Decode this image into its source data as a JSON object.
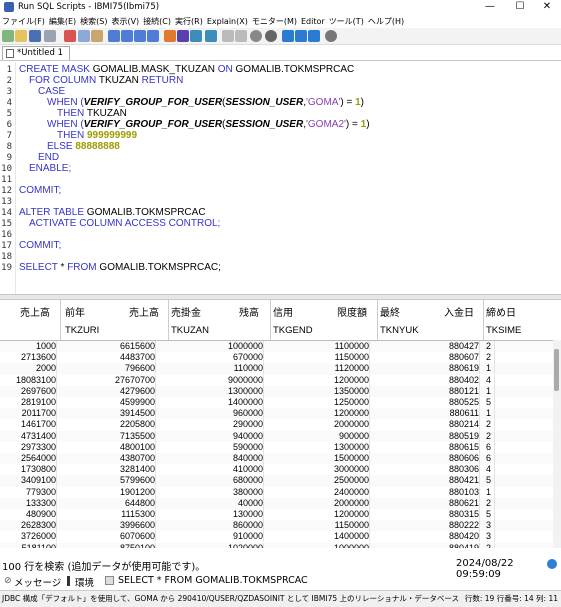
{
  "window": {
    "title": "Run SQL Scripts - IBMI75(Ibmi75)"
  },
  "menu": [
    "ファイル(F)",
    "編集(E)",
    "検索(S)",
    "表示(V)",
    "接続(C)",
    "実行(R)",
    "Explain(X)",
    "モニター(M)",
    "Editor",
    "ツール(T)",
    "ヘルプ(H)"
  ],
  "tab": {
    "label": "*Untitled 1"
  },
  "editor": {
    "line_numbers": [
      "1",
      "2",
      "3",
      "4",
      "5",
      "6",
      "7",
      "8",
      "9",
      "10",
      "11",
      "12",
      "13",
      "14",
      "15",
      "16",
      "17",
      "18",
      "19"
    ],
    "l1": [
      "CREATE MASK",
      " GOMALIB.MASK_TKUZAN ",
      "ON",
      " GOMALIB.TOKMSPRCAC"
    ],
    "l2": [
      "FOR COLUMN",
      " TKUZAN ",
      "RETURN"
    ],
    "l3": "CASE",
    "l4": [
      "WHEN (",
      "VERIFY_GROUP_FOR_USER",
      "(",
      "SESSION_USER",
      ",",
      "'GOMA'",
      ") = ",
      "1",
      ")"
    ],
    "l5": [
      "THEN",
      " TKUZAN"
    ],
    "l6": [
      "WHEN (",
      "VERIFY_GROUP_FOR_USER",
      "(",
      "SESSION_USER",
      ",",
      "'GOMA2'",
      ") = ",
      "1",
      ")"
    ],
    "l7": [
      "THEN ",
      "999999999"
    ],
    "l8": [
      "ELSE ",
      "88888888"
    ],
    "l9": "END",
    "l10": "ENABLE;",
    "l12": "COMMIT;",
    "l14": [
      "ALTER TABLE",
      " GOMALIB.TOKMSPRCAC"
    ],
    "l15": "ACTIVATE COLUMN ACCESS CONTROL;",
    "l17": "COMMIT;",
    "l19": [
      "SELECT",
      " * ",
      "FROM",
      " GOMALIB.TOKMSPRCAC;"
    ]
  },
  "grid": {
    "headers": [
      {
        "title": "売上高",
        "col": ""
      },
      {
        "title": "前年",
        "title2": "売上高",
        "col": "TKZURI"
      },
      {
        "title": "売掛金",
        "title2": "残高",
        "col": "TKUZAN"
      },
      {
        "title": "信用",
        "title2": "限度額",
        "col": "TKGEND"
      },
      {
        "title": "最終",
        "title2": "入金日",
        "col": "TKNYUK"
      },
      {
        "title": "締め日",
        "col": "TKSIME"
      }
    ],
    "rows": [
      [
        "1000",
        "6615600",
        "1000000",
        "1100000",
        "880427",
        "2"
      ],
      [
        "2713600",
        "4483700",
        "670000",
        "1150000",
        "880607",
        "2"
      ],
      [
        "2000",
        "796600",
        "110000",
        "1120000",
        "880619",
        "1"
      ],
      [
        "18083100",
        "27670700",
        "9000000",
        "1200000",
        "880402",
        "4"
      ],
      [
        "2697600",
        "4279600",
        "1300000",
        "1350000",
        "880121",
        "1"
      ],
      [
        "2819100",
        "4599900",
        "1400000",
        "1250000",
        "880525",
        "5"
      ],
      [
        "2011700",
        "3914500",
        "960000",
        "1200000",
        "880611",
        "1"
      ],
      [
        "1461700",
        "2205800",
        "290000",
        "2000000",
        "880214",
        "2"
      ],
      [
        "4731400",
        "7135500",
        "940000",
        "900000",
        "880519",
        "2"
      ],
      [
        "2973300",
        "4800100",
        "590000",
        "1300000",
        "880615",
        "6"
      ],
      [
        "2564000",
        "4380700",
        "840000",
        "1500000",
        "880606",
        "6"
      ],
      [
        "1730800",
        "3281400",
        "410000",
        "3000000",
        "880306",
        "4"
      ],
      [
        "3409100",
        "5799600",
        "680000",
        "2500000",
        "880421",
        "5"
      ],
      [
        "779300",
        "1901200",
        "380000",
        "2400000",
        "880103",
        "1"
      ],
      [
        "133300",
        "644800",
        "40000",
        "2000000",
        "880621",
        "2"
      ],
      [
        "480900",
        "1115300",
        "130000",
        "1200000",
        "880315",
        "5"
      ],
      [
        "2628300",
        "3996600",
        "860000",
        "1150000",
        "880222",
        "3"
      ],
      [
        "3726000",
        "6070600",
        "910000",
        "1400000",
        "880420",
        "3"
      ],
      [
        "5181100",
        "8750100",
        "1020000",
        "1000000",
        "880419",
        "2"
      ]
    ]
  },
  "status": {
    "left": "100 行を検索 (追加データが使用可能です)。",
    "right": "2024/08/22 09:59:09"
  },
  "bottom_tabs": {
    "messages": "メッセージ",
    "env": "環境",
    "result": "SELECT * FROM GOMALIB.TOKMSPRCAC"
  },
  "footer": {
    "text": "JDBC 構成「デフォルト」を使用して、GOMA から 290410/QUSER/QZDASOINIT として IBMI75 上のリレーショナル・データベース Ibmi75 に接続されました。",
    "pos": "行数: 19 行番号: 14 列: 11"
  }
}
